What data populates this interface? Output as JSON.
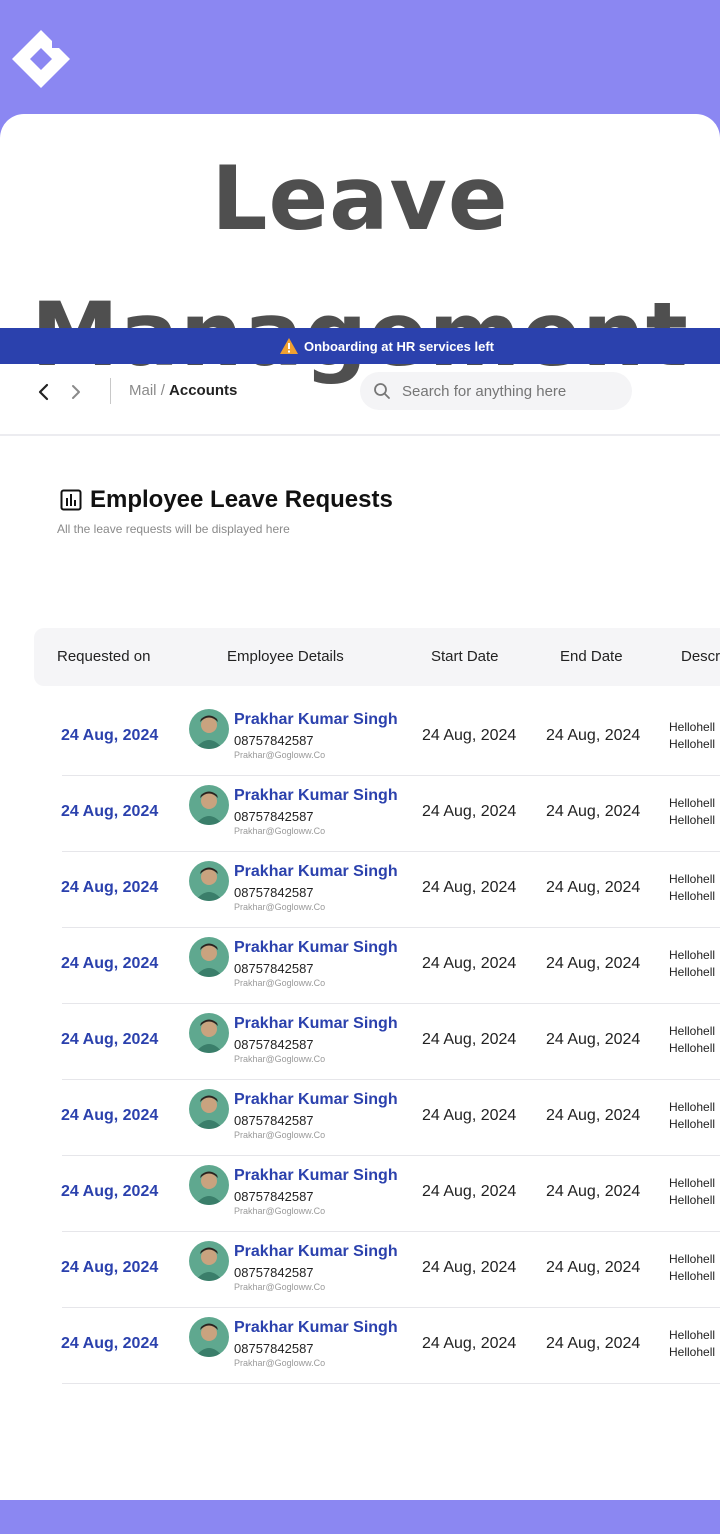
{
  "hero": {
    "line1": "Leave",
    "line2": "Management"
  },
  "notice": {
    "text": "Onboarding at HR services left",
    "icon": "warning-icon"
  },
  "topbar": {
    "crumb_parent": "Mail",
    "crumb_sep": "/",
    "crumb_current": "Accounts",
    "search_placeholder": "Search for anything here"
  },
  "page": {
    "title": "Employee Leave Requests",
    "subtitle": "All the leave requests will be displayed here"
  },
  "table": {
    "columns": [
      "Requested on",
      "Employee Details",
      "Start Date",
      "End Date",
      "Descr"
    ],
    "rows": [
      {
        "requested_on": "24 Aug, 2024",
        "name": "Prakhar Kumar Singh",
        "phone": "08757842587",
        "email": "Prakhar@Gogloww.Co",
        "start": "24 Aug, 2024",
        "end": "24 Aug, 2024",
        "desc1": "Hellohell",
        "desc2": "Hellohell"
      },
      {
        "requested_on": "24 Aug, 2024",
        "name": "Prakhar Kumar Singh",
        "phone": "08757842587",
        "email": "Prakhar@Gogloww.Co",
        "start": "24 Aug, 2024",
        "end": "24 Aug, 2024",
        "desc1": "Hellohell",
        "desc2": "Hellohell"
      },
      {
        "requested_on": "24 Aug, 2024",
        "name": "Prakhar Kumar Singh",
        "phone": "08757842587",
        "email": "Prakhar@Gogloww.Co",
        "start": "24 Aug, 2024",
        "end": "24 Aug, 2024",
        "desc1": "Hellohell",
        "desc2": "Hellohell"
      },
      {
        "requested_on": "24 Aug, 2024",
        "name": "Prakhar Kumar Singh",
        "phone": "08757842587",
        "email": "Prakhar@Gogloww.Co",
        "start": "24 Aug, 2024",
        "end": "24 Aug, 2024",
        "desc1": "Hellohell",
        "desc2": "Hellohell"
      },
      {
        "requested_on": "24 Aug, 2024",
        "name": "Prakhar Kumar Singh",
        "phone": "08757842587",
        "email": "Prakhar@Gogloww.Co",
        "start": "24 Aug, 2024",
        "end": "24 Aug, 2024",
        "desc1": "Hellohell",
        "desc2": "Hellohell"
      },
      {
        "requested_on": "24 Aug, 2024",
        "name": "Prakhar Kumar Singh",
        "phone": "08757842587",
        "email": "Prakhar@Gogloww.Co",
        "start": "24 Aug, 2024",
        "end": "24 Aug, 2024",
        "desc1": "Hellohell",
        "desc2": "Hellohell"
      },
      {
        "requested_on": "24 Aug, 2024",
        "name": "Prakhar Kumar Singh",
        "phone": "08757842587",
        "email": "Prakhar@Gogloww.Co",
        "start": "24 Aug, 2024",
        "end": "24 Aug, 2024",
        "desc1": "Hellohell",
        "desc2": "Hellohell"
      },
      {
        "requested_on": "24 Aug, 2024",
        "name": "Prakhar Kumar Singh",
        "phone": "08757842587",
        "email": "Prakhar@Gogloww.Co",
        "start": "24 Aug, 2024",
        "end": "24 Aug, 2024",
        "desc1": "Hellohell",
        "desc2": "Hellohell"
      },
      {
        "requested_on": "24 Aug, 2024",
        "name": "Prakhar Kumar Singh",
        "phone": "08757842587",
        "email": "Prakhar@Gogloww.Co",
        "start": "24 Aug, 2024",
        "end": "24 Aug, 2024",
        "desc1": "Hellohell",
        "desc2": "Hellohell"
      }
    ]
  },
  "colors": {
    "background": "#8b87f2",
    "accent": "#2b41ad",
    "hero_text": "#4f4f4f"
  }
}
